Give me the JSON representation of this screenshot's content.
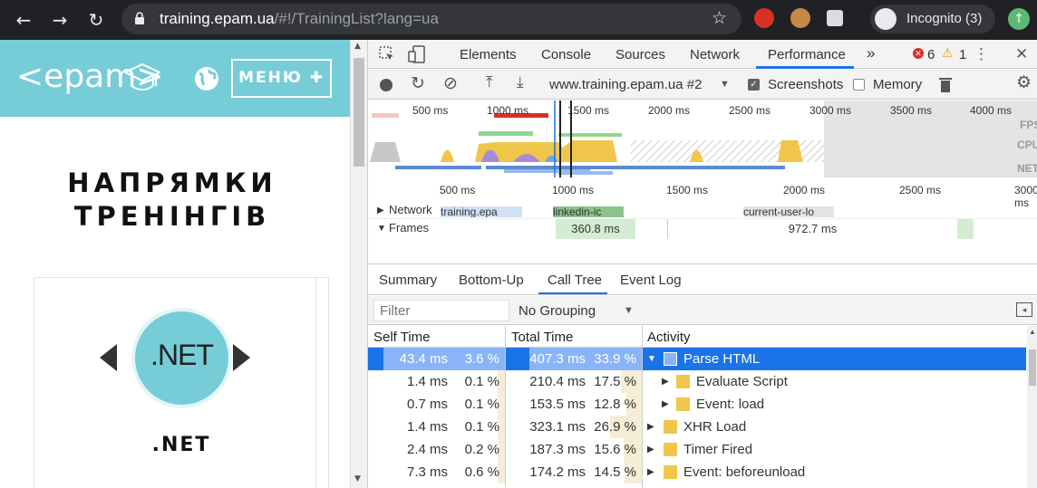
{
  "browser": {
    "url_host": "training.epam.ua",
    "url_path": "/#!/TrainingList?lang=ua",
    "incognito_label": "Incognito (3)"
  },
  "page": {
    "logo": "<epam>",
    "menu_label": "МЕНЮ ✚",
    "heading_line1": "НАПРЯМКИ",
    "heading_line2": "ТРЕНІНГІВ",
    "card_logo": ".NET",
    "card_title": ".NET"
  },
  "devtools": {
    "tabs": [
      "Elements",
      "Console",
      "Sources",
      "Network",
      "Performance"
    ],
    "more": "»",
    "errors": "6",
    "warnings": "1",
    "toolbar": {
      "profile": "www.training.epam.ua #2",
      "screenshots": "Screenshots",
      "memory": "Memory"
    },
    "overview_ticks": [
      "500 ms",
      "1000 ms",
      "1500 ms",
      "2000 ms",
      "2500 ms",
      "3000 ms",
      "3500 ms",
      "4000 ms"
    ],
    "overview_lanes": [
      "FPS",
      "CPU",
      "NET"
    ],
    "flame_ticks": [
      "500 ms",
      "1000 ms",
      "1500 ms",
      "2000 ms",
      "2500 ms",
      "3000 ms"
    ],
    "network_label": "Network",
    "network_items": [
      "training.epa",
      "linkedin-ic",
      "current-user-lo"
    ],
    "frames_label": "Frames",
    "frame_durations": [
      "360.8 ms",
      "972.7 ms"
    ],
    "bottom_tabs": [
      "Summary",
      "Bottom-Up",
      "Call Tree",
      "Event Log"
    ],
    "filter_placeholder": "Filter",
    "grouping": "No Grouping",
    "columns": [
      "Self Time",
      "Total Time",
      "Activity"
    ],
    "rows": [
      {
        "self": "43.4 ms",
        "self_pct": "3.6 %",
        "total": "407.3 ms",
        "total_pct": "33.9 %",
        "activity": "Parse HTML",
        "selected": true,
        "expanded": true
      },
      {
        "self": "1.4 ms",
        "self_pct": "0.1 %",
        "total": "210.4 ms",
        "total_pct": "17.5 %",
        "activity": "Evaluate Script",
        "child": true
      },
      {
        "self": "0.7 ms",
        "self_pct": "0.1 %",
        "total": "153.5 ms",
        "total_pct": "12.8 %",
        "activity": "Event: load",
        "child": true
      },
      {
        "self": "1.4 ms",
        "self_pct": "0.1 %",
        "total": "323.1 ms",
        "total_pct": "26.9 %",
        "activity": "XHR Load"
      },
      {
        "self": "2.4 ms",
        "self_pct": "0.2 %",
        "total": "187.3 ms",
        "total_pct": "15.6 %",
        "activity": "Timer Fired"
      },
      {
        "self": "7.3 ms",
        "self_pct": "0.6 %",
        "total": "174.2 ms",
        "total_pct": "14.5 %",
        "activity": "Event: beforeunload"
      }
    ]
  }
}
